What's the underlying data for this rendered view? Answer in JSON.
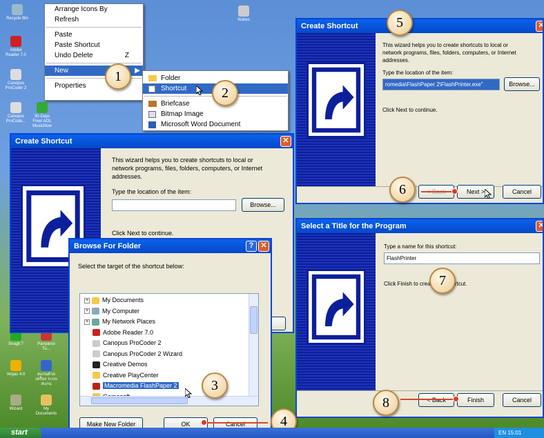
{
  "desktop": {
    "icons": [
      {
        "label": "Recycle Bin"
      },
      {
        "label": "Adobe Reader 7.0"
      },
      {
        "label": "Canopus ProCoder 2"
      },
      {
        "label": "Canopus ProCode..."
      },
      {
        "label": "30-Days Free! AOL MusicNow"
      },
      {
        "label": "Nubes"
      },
      {
        "label": "Snagit 7"
      },
      {
        "label": "Panyaroo Tu..."
      },
      {
        "label": "Vegas 4.0"
      },
      {
        "label": "สแกนด้วยเครื่อง ระบบสแกน"
      },
      {
        "label": "Wizard"
      },
      {
        "label": "My Documents"
      }
    ]
  },
  "context_menu": {
    "items": [
      "Arrange Icons By",
      "Refresh",
      "Paste",
      "Paste Shortcut",
      "Undo Delete",
      "New",
      "Properties"
    ],
    "shortcut_hint": "Z"
  },
  "new_submenu": {
    "items": [
      "Folder",
      "Shortcut",
      "Briefcase",
      "Bitmap Image",
      "Microsoft Word Document"
    ]
  },
  "create_shortcut_main": {
    "title": "Create Shortcut",
    "intro": [
      "This wizard helps you to create shortcuts to local or",
      "network programs, files, folders, computers, or Internet",
      "addresses."
    ],
    "location_label": "Type the location of the item:",
    "location_value": "",
    "browse_label": "Browse...",
    "continue_text": "Click Next to continue."
  },
  "browse_folder": {
    "title": "Browse For Folder",
    "help": "?",
    "close": "✕",
    "prompt": "Select the target of the shortcut below:",
    "tree": [
      "My Documents",
      "My Computer",
      "My Network Places",
      "Adobe Reader 7.0",
      "Canopus ProCoder 2",
      "Canopus ProCoder 2 Wizard",
      "Creative Demos",
      "Creative PlayCenter",
      "Macromedia FlashPaper 2",
      "Gamesoft..."
    ],
    "make_new_folder": "Make New Folder",
    "ok": "OK",
    "cancel": "Cancel"
  },
  "create_shortcut_step5": {
    "title": "Create Shortcut",
    "intro": [
      "This wizard helps you to create shortcuts to local or",
      "network programs, files, folders, computers, or Internet",
      "addresses."
    ],
    "location_label": "Type the location of the item:",
    "location_value": "romedia\\FlashPaper 2\\FlashPrinter.exe\"",
    "browse_label": "Browse...",
    "continue_text": "Click Next to continue.",
    "back": "< Back",
    "next": "Next >",
    "cancel": "Cancel"
  },
  "title_program": {
    "title": "Select a Title for the Program",
    "name_label": "Type a name for this shortcut:",
    "name_value": "FlashPrinter",
    "finish_text": "Click Finish to create the shortcut.",
    "back": "< Back",
    "finish": "Finish",
    "cancel": "Cancel"
  },
  "callouts": [
    "1",
    "2",
    "3",
    "4",
    "5",
    "6",
    "7",
    "8"
  ],
  "taskbar": {
    "start": "start",
    "clock": "EN 15:01"
  },
  "colors": {
    "accent": "#0a46d4",
    "annotation": "#d8452a",
    "callout_fill": "#f1d6a6"
  }
}
